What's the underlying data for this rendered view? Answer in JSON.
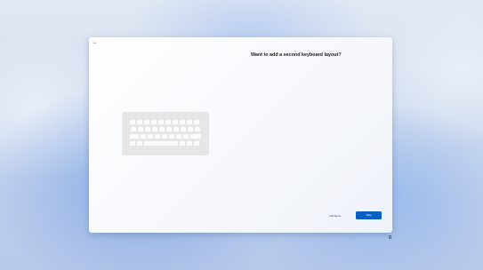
{
  "dialog": {
    "back_icon": "←",
    "title": "Want to add a second keyboard layout?",
    "illustration": "keyboard-illustration",
    "add_layout_label": "Add layout",
    "skip_label": "Skip"
  },
  "taskbar": {
    "accessibility_icon": "accessibility-icon"
  },
  "colors": {
    "accent": "#0a5fc4",
    "dialog_bg": "#ffffff",
    "keyboard_bg": "#e6e6e6"
  }
}
